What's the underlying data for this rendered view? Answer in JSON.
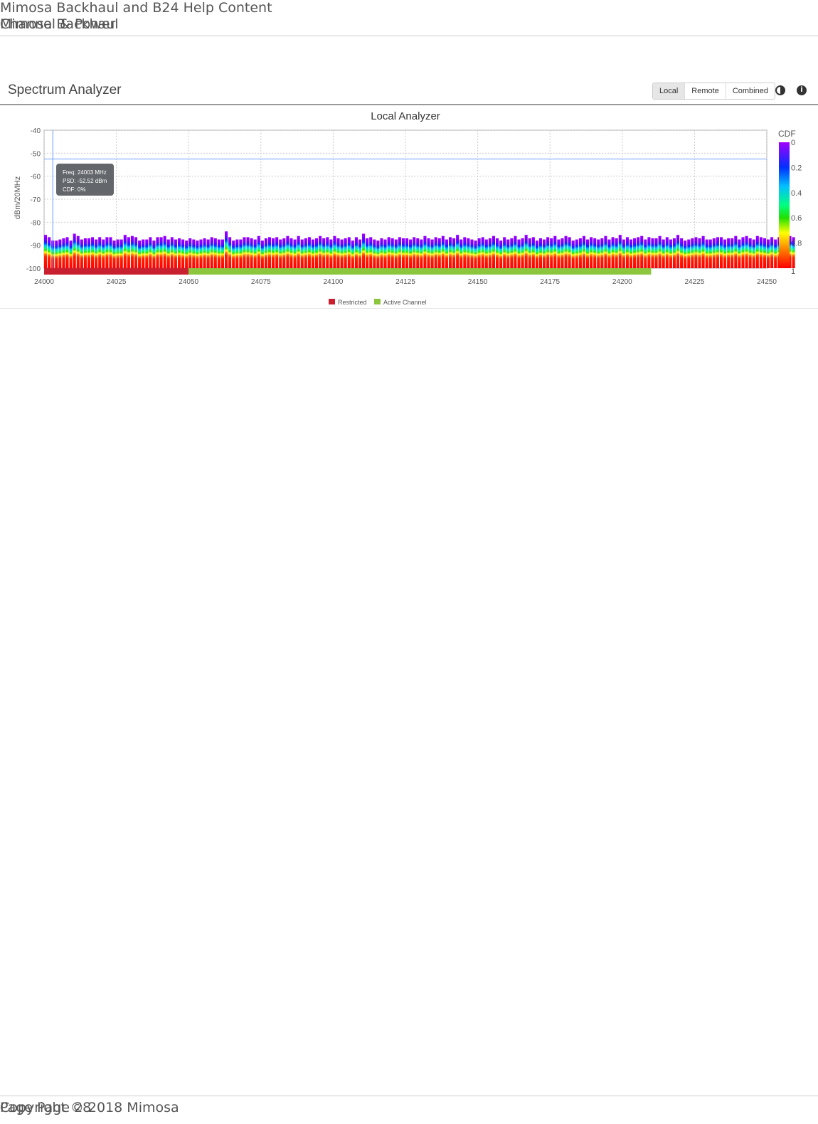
{
  "header": {
    "doc_title": "Mimosa Backhaul and B24 Help Content",
    "section": "Mimosa Backhaul",
    "topic": "Channel & Power"
  },
  "panel": {
    "title": "Spectrum Analyzer",
    "buttons": [
      "Local",
      "Remote",
      "Combined"
    ],
    "selected": "Local",
    "icons": [
      "contrast-icon",
      "info-icon"
    ]
  },
  "footer": {
    "copyright": "Copyright © 2018 Mimosa",
    "page": "Page Page 28"
  },
  "chart_data": {
    "type": "heatmap",
    "title": "Local Analyzer",
    "ylabel": "dBm/20MHz",
    "xlim": [
      24000,
      24250
    ],
    "ylim": [
      -100,
      -40
    ],
    "xticks": [
      24000,
      24025,
      24050,
      24075,
      24100,
      24125,
      24150,
      24175,
      24200,
      24225,
      24250
    ],
    "yticks": [
      -40,
      -50,
      -60,
      -70,
      -80,
      -90,
      -100
    ],
    "grid": true,
    "colorbar": {
      "label": "CDF",
      "ticks": [
        "0",
        "0.2",
        "0.4",
        "0.6",
        "0.8",
        "1"
      ],
      "colors": [
        "#a000ff",
        "#0030ff",
        "#00c0ff",
        "#00ff80",
        "#40e000",
        "#ffff00",
        "#ff8000",
        "#ff0000"
      ]
    },
    "bar_start": 24000,
    "bar_step": 1.25,
    "peaks": [
      -85.5,
      -86.5,
      -88,
      -88,
      -87.5,
      -87,
      -86.5,
      -88,
      -85,
      -86,
      -87.5,
      -87,
      -87,
      -86.5,
      -87.5,
      -86.5,
      -87.5,
      -86.5,
      -86.5,
      -88,
      -87.5,
      -87.5,
      -85.5,
      -86.5,
      -86,
      -86.5,
      -88,
      -87.5,
      -87.5,
      -86.5,
      -88,
      -86.5,
      -86.5,
      -86,
      -87.5,
      -86.5,
      -87.5,
      -87,
      -87.5,
      -88,
      -87,
      -87.5,
      -88,
      -87.5,
      -87,
      -87.5,
      -86.5,
      -87,
      -87.5,
      -87.5,
      -84,
      -86.5,
      -88,
      -87.5,
      -87.5,
      -86.5,
      -86.5,
      -87,
      -87.5,
      -86,
      -88,
      -87,
      -86.5,
      -87,
      -86.5,
      -87.5,
      -87,
      -86,
      -87,
      -87.5,
      -86,
      -87.5,
      -87,
      -86.5,
      -87.5,
      -87,
      -86,
      -87,
      -86.5,
      -87.5,
      -86,
      -87,
      -87.5,
      -87,
      -86.5,
      -88,
      -86.5,
      -87.5,
      -85,
      -87,
      -86.5,
      -87.5,
      -88,
      -87,
      -87.5,
      -86.5,
      -87,
      -87.5,
      -86.5,
      -87,
      -87,
      -87.5,
      -86.5,
      -87,
      -87.5,
      -86,
      -87,
      -87.5,
      -86.5,
      -87,
      -86,
      -87.5,
      -86.5,
      -87,
      -85.5,
      -87.5,
      -86.5,
      -87,
      -87.5,
      -88,
      -87,
      -86.5,
      -87.5,
      -87,
      -86,
      -87,
      -88,
      -86.5,
      -87.5,
      -87,
      -86,
      -87.5,
      -87,
      -85.5,
      -87,
      -86.5,
      -88,
      -87,
      -87.5,
      -86.5,
      -87,
      -86,
      -87.5,
      -87,
      -86,
      -86.5,
      -88,
      -87.5,
      -87,
      -86,
      -87.5,
      -86.5,
      -87,
      -87.5,
      -87,
      -86,
      -87.5,
      -86.5,
      -87,
      -85.5,
      -87.5,
      -86.5,
      -87.5,
      -87,
      -86.5,
      -86,
      -87.5,
      -86.5,
      -87,
      -87,
      -86,
      -87.5,
      -86.5,
      -87.5,
      -87,
      -85.5,
      -87,
      -88,
      -87.5,
      -87,
      -86.5,
      -87,
      -86,
      -87.5,
      -87.5,
      -87,
      -86.5,
      -86.5,
      -87.5,
      -87,
      -87,
      -86,
      -87.5,
      -86.5,
      -86,
      -87,
      -87.5,
      -86,
      -86.5,
      -87,
      -87.5,
      -86.5,
      -87.5,
      -86.5,
      -87.5,
      -86,
      -86,
      -86.5
    ],
    "bands": [
      {
        "name": "Restricted",
        "from": 24000,
        "to": 24050,
        "color": "#c8202f"
      },
      {
        "name": "Active Channel",
        "from": 24050,
        "to": 24210,
        "color": "#8cc63f"
      }
    ],
    "crosshair": {
      "freq": 24003,
      "psd": -52.52
    },
    "tooltip": [
      "Freq: 24003 MHz",
      "PSD: -52.52 dBm",
      "CDF: 0%"
    ],
    "legend": [
      "Restricted",
      "Active Channel"
    ],
    "legend_position": "bottom"
  }
}
